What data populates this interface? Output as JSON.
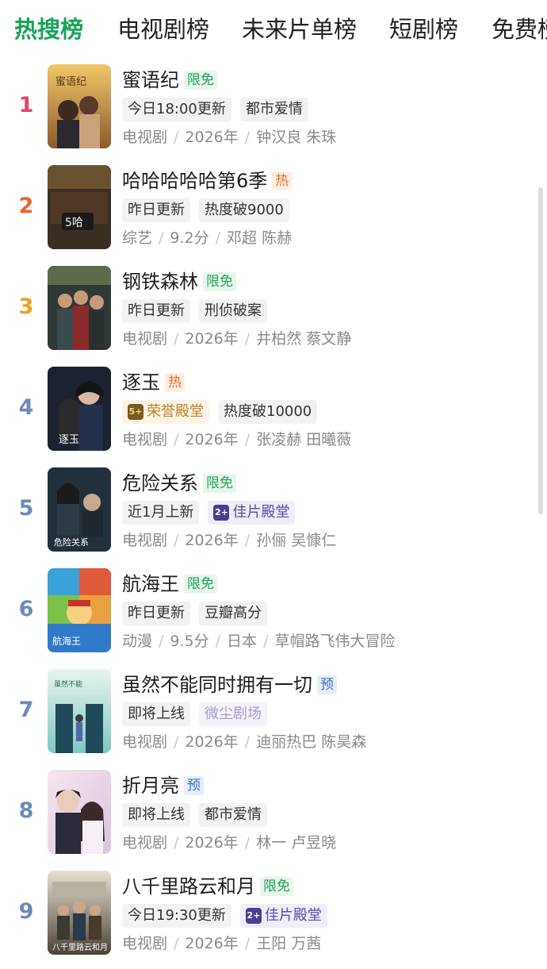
{
  "tabs": [
    {
      "label": "热搜榜",
      "active": true
    },
    {
      "label": "电视剧榜",
      "active": false
    },
    {
      "label": "未来片单榜",
      "active": false
    },
    {
      "label": "短剧榜",
      "active": false
    },
    {
      "label": "免费榜",
      "active": false
    }
  ],
  "colors": {
    "accent": "#1aa35a",
    "rank_1": "#e0446a",
    "rank_2": "#e8642c",
    "rank_3": "#f0a020",
    "rank_other": "#6d8ab8"
  },
  "items": [
    {
      "rank": "1",
      "title": "蜜语纪",
      "badge": {
        "text": "限免",
        "kind": "free"
      },
      "tags": [
        {
          "text": "今日18:00更新",
          "style": "plain"
        },
        {
          "text": "都市爱情",
          "style": "plain"
        }
      ],
      "meta": [
        "电视剧",
        "2026年",
        "钟汉良 朱珠"
      ]
    },
    {
      "rank": "2",
      "title": "哈哈哈哈哈第6季",
      "badge": {
        "text": "热",
        "kind": "hot"
      },
      "tags": [
        {
          "text": "昨日更新",
          "style": "plain"
        },
        {
          "text": "热度破9000",
          "style": "plain"
        }
      ],
      "meta": [
        "综艺",
        "9.2分",
        "邓超 陈赫"
      ]
    },
    {
      "rank": "3",
      "title": "钢铁森林",
      "badge": {
        "text": "限免",
        "kind": "free"
      },
      "tags": [
        {
          "text": "昨日更新",
          "style": "plain"
        },
        {
          "text": "刑侦破案",
          "style": "plain"
        }
      ],
      "meta": [
        "电视剧",
        "2026年",
        "井柏然 蔡文静"
      ]
    },
    {
      "rank": "4",
      "title": "逐玉",
      "badge": {
        "text": "热",
        "kind": "hot"
      },
      "tags": [
        {
          "text": "荣誉殿堂",
          "style": "gold",
          "icon": "5+"
        },
        {
          "text": "热度破10000",
          "style": "plain"
        }
      ],
      "meta": [
        "电视剧",
        "2026年",
        "张凌赫 田曦薇"
      ]
    },
    {
      "rank": "5",
      "title": "危险关系",
      "badge": {
        "text": "限免",
        "kind": "free"
      },
      "tags": [
        {
          "text": "近1月上新",
          "style": "plain"
        },
        {
          "text": "佳片殿堂",
          "style": "purple",
          "icon": "2+"
        }
      ],
      "meta": [
        "电视剧",
        "2026年",
        "孙俪 吴慷仁"
      ]
    },
    {
      "rank": "6",
      "title": "航海王",
      "badge": {
        "text": "限免",
        "kind": "free"
      },
      "tags": [
        {
          "text": "昨日更新",
          "style": "plain"
        },
        {
          "text": "豆瓣高分",
          "style": "plain"
        }
      ],
      "meta": [
        "动漫",
        "9.5分",
        "日本",
        "草帽路飞伟大冒险"
      ]
    },
    {
      "rank": "7",
      "title": "虽然不能同时拥有一切",
      "badge": {
        "text": "预",
        "kind": "pre"
      },
      "tags": [
        {
          "text": "即将上线",
          "style": "plain"
        },
        {
          "text": "微尘剧场",
          "style": "lavender"
        }
      ],
      "meta": [
        "电视剧",
        "2026年",
        "迪丽热巴 陈昊森"
      ]
    },
    {
      "rank": "8",
      "title": "折月亮",
      "badge": {
        "text": "预",
        "kind": "pre"
      },
      "tags": [
        {
          "text": "即将上线",
          "style": "plain"
        },
        {
          "text": "都市爱情",
          "style": "plain"
        }
      ],
      "meta": [
        "电视剧",
        "2026年",
        "林一 卢昱晓"
      ]
    },
    {
      "rank": "9",
      "title": "八千里路云和月",
      "badge": {
        "text": "限免",
        "kind": "free"
      },
      "tags": [
        {
          "text": "今日19:30更新",
          "style": "plain"
        },
        {
          "text": "佳片殿堂",
          "style": "purple",
          "icon": "2+"
        }
      ],
      "meta": [
        "电视剧",
        "2026年",
        "王阳 万茜"
      ]
    }
  ]
}
